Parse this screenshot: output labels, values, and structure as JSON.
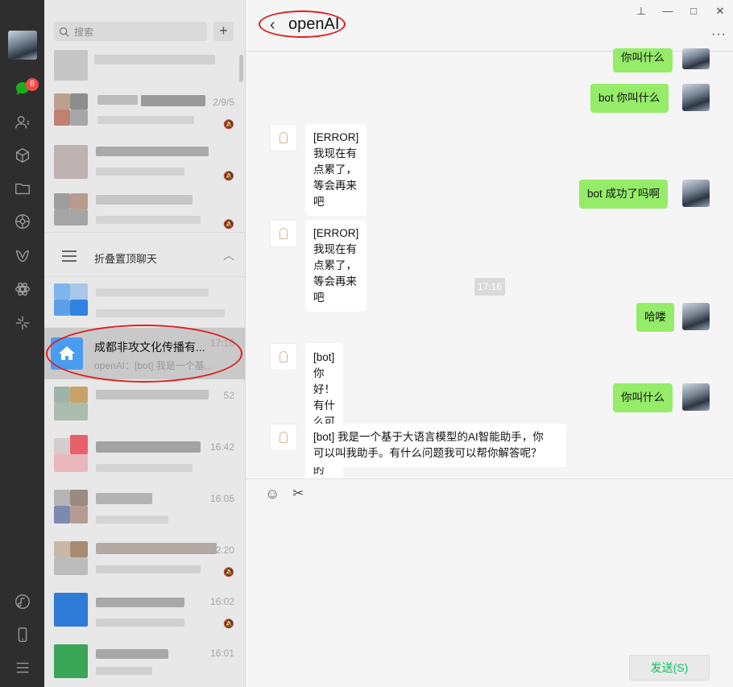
{
  "sidebar": {
    "unread_badge": "8",
    "icons": [
      "chat-icon",
      "contacts-icon",
      "favorites-icon",
      "files-icon",
      "moments-icon",
      "channels-icon",
      "mini-programs-icon",
      "top-stories-icon",
      "music-icon",
      "phone-icon",
      "menu-icon"
    ]
  },
  "chat_list": {
    "search_placeholder": "搜索",
    "add_button": "+",
    "rows_top": [
      {
        "time": "",
        "muted": false
      },
      {
        "time": "2/9/5",
        "muted": true
      },
      {
        "time": "",
        "muted": true
      },
      {
        "time": "",
        "muted": true
      }
    ],
    "fold_label": "折叠置顶聊天",
    "active": {
      "name": "成都非攻文化传播有...",
      "time": "17:16",
      "preview": "openAI：[bot] 我是一个基..."
    },
    "rows_bottom": [
      {
        "time": "52",
        "muted": false
      },
      {
        "time": "16:42",
        "muted": false
      },
      {
        "time": "16:05",
        "muted": false
      },
      {
        "time": "12:20",
        "muted": true
      },
      {
        "time": "16:02",
        "muted": true
      },
      {
        "time": "16:01",
        "muted": false
      }
    ]
  },
  "conversation": {
    "back": "‹",
    "title": "openAI",
    "more": "···",
    "window_controls": {
      "pin": "⊥",
      "minimize": "—",
      "maximize": "□",
      "close": "✕"
    },
    "messages": [
      {
        "from": "me",
        "text": "你叫什么"
      },
      {
        "from": "me",
        "text": "bot 你叫什么"
      },
      {
        "from": "bot",
        "lines": [
          "[ERROR]",
          "我现在有点累了，等会再来吧"
        ]
      },
      {
        "from": "me",
        "text": "bot 成功了吗啊"
      },
      {
        "from": "bot",
        "lines": [
          "[ERROR]",
          "我现在有点累了，等会再来吧"
        ]
      },
      {
        "from": "time",
        "text": "17:16"
      },
      {
        "from": "me",
        "text": "哈喽"
      },
      {
        "from": "bot",
        "lines": [
          "[bot] 你好！有什么可以帮助你的吗？"
        ]
      },
      {
        "from": "me",
        "text": "你叫什么"
      },
      {
        "from": "bot",
        "lines": [
          "[bot] 我是一个基于大语言模型的AI智能助手，你",
          "可以叫我助手。有什么问题我可以帮你解答呢？"
        ]
      }
    ],
    "composer": {
      "emoji_icon": "☺",
      "screenshot_icon": "✂",
      "send_label": "发送(S)"
    }
  },
  "colors": {
    "rail": "#2e2e2e",
    "my_bubble": "#95ec69",
    "send_text": "#07c160",
    "badge": "#f44c4c",
    "annotation": "#e02020"
  }
}
